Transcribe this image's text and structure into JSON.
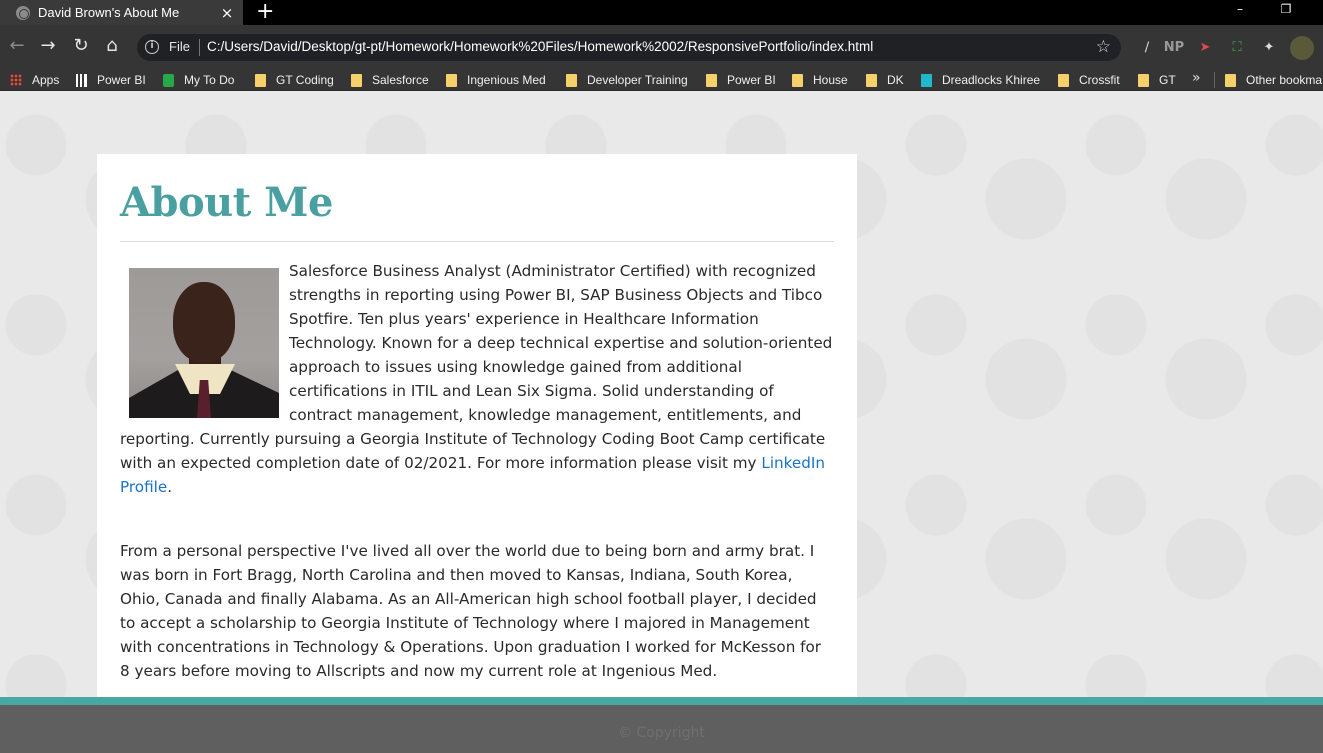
{
  "tab": {
    "title": "David Brown's About Me",
    "close": "×",
    "new_tab": "+"
  },
  "window": {
    "minimize": "–",
    "restore": "❐"
  },
  "toolbar": {
    "scheme": "File",
    "url": "C:/Users/David/Desktop/gt-pt/Homework/Homework%20Files/Homework%2002/ResponsivePortfolio/index.html",
    "info_icon": "i"
  },
  "extensions": {
    "np": "NP"
  },
  "bookmarks": [
    {
      "label": "Apps",
      "icon": "apps-icon"
    },
    {
      "label": "Power BI",
      "icon": "chart-icon"
    },
    {
      "label": "My To Do",
      "icon": "todo-icon"
    },
    {
      "label": "GT Coding",
      "icon": "folder-icon"
    },
    {
      "label": "Salesforce",
      "icon": "folder-icon"
    },
    {
      "label": "Ingenious Med",
      "icon": "folder-icon"
    },
    {
      "label": "Developer Training",
      "icon": "folder-icon"
    },
    {
      "label": "Power BI",
      "icon": "folder-icon"
    },
    {
      "label": "House",
      "icon": "folder-icon"
    },
    {
      "label": "DK",
      "icon": "folder-icon"
    },
    {
      "label": "Dreadlocks Khiree",
      "icon": "dk-icon"
    },
    {
      "label": "Crossfit",
      "icon": "folder-icon"
    },
    {
      "label": "GT",
      "icon": "folder-icon"
    },
    {
      "label": "Other bookma",
      "icon": "folder-icon"
    }
  ],
  "bookmarks_more": "»",
  "page": {
    "heading": "About Me",
    "intro_text": "Salesforce Business Analyst (Administrator Certified) with recognized strengths in reporting using Power BI, SAP Business Objects and Tibco Spotfire. Ten plus years' experience in Healthcare Information Technology. Known for a deep technical expertise and solution-oriented approach to issues using knowledge gained from additional certifications in ITIL and Lean Six Sigma. Solid understanding of contract management, knowledge management, entitlements, and reporting. Currently pursuing a Georgia Institute of Technology Coding Boot Camp certificate with an expected completion date of 02/2021. For more information please visit my ",
    "link_text": "LinkedIn Profile",
    "intro_end": ".",
    "personal_text": "From a personal perspective I've lived all over the world due to being born and army brat. I was born in Fort Bragg, North Carolina and then moved to Kansas, Indiana, South Korea, Ohio, Canada and finally Alabama. As an All-American high school football player, I decided to accept a scholarship to Georgia Institute of Technology where I majored in Management with concentrations in Technology & Operations. Upon graduation I worked for McKesson for 8 years before moving to Allscripts and now my current role at Ingenious Med."
  },
  "footer": {
    "text": "© Copyright"
  }
}
